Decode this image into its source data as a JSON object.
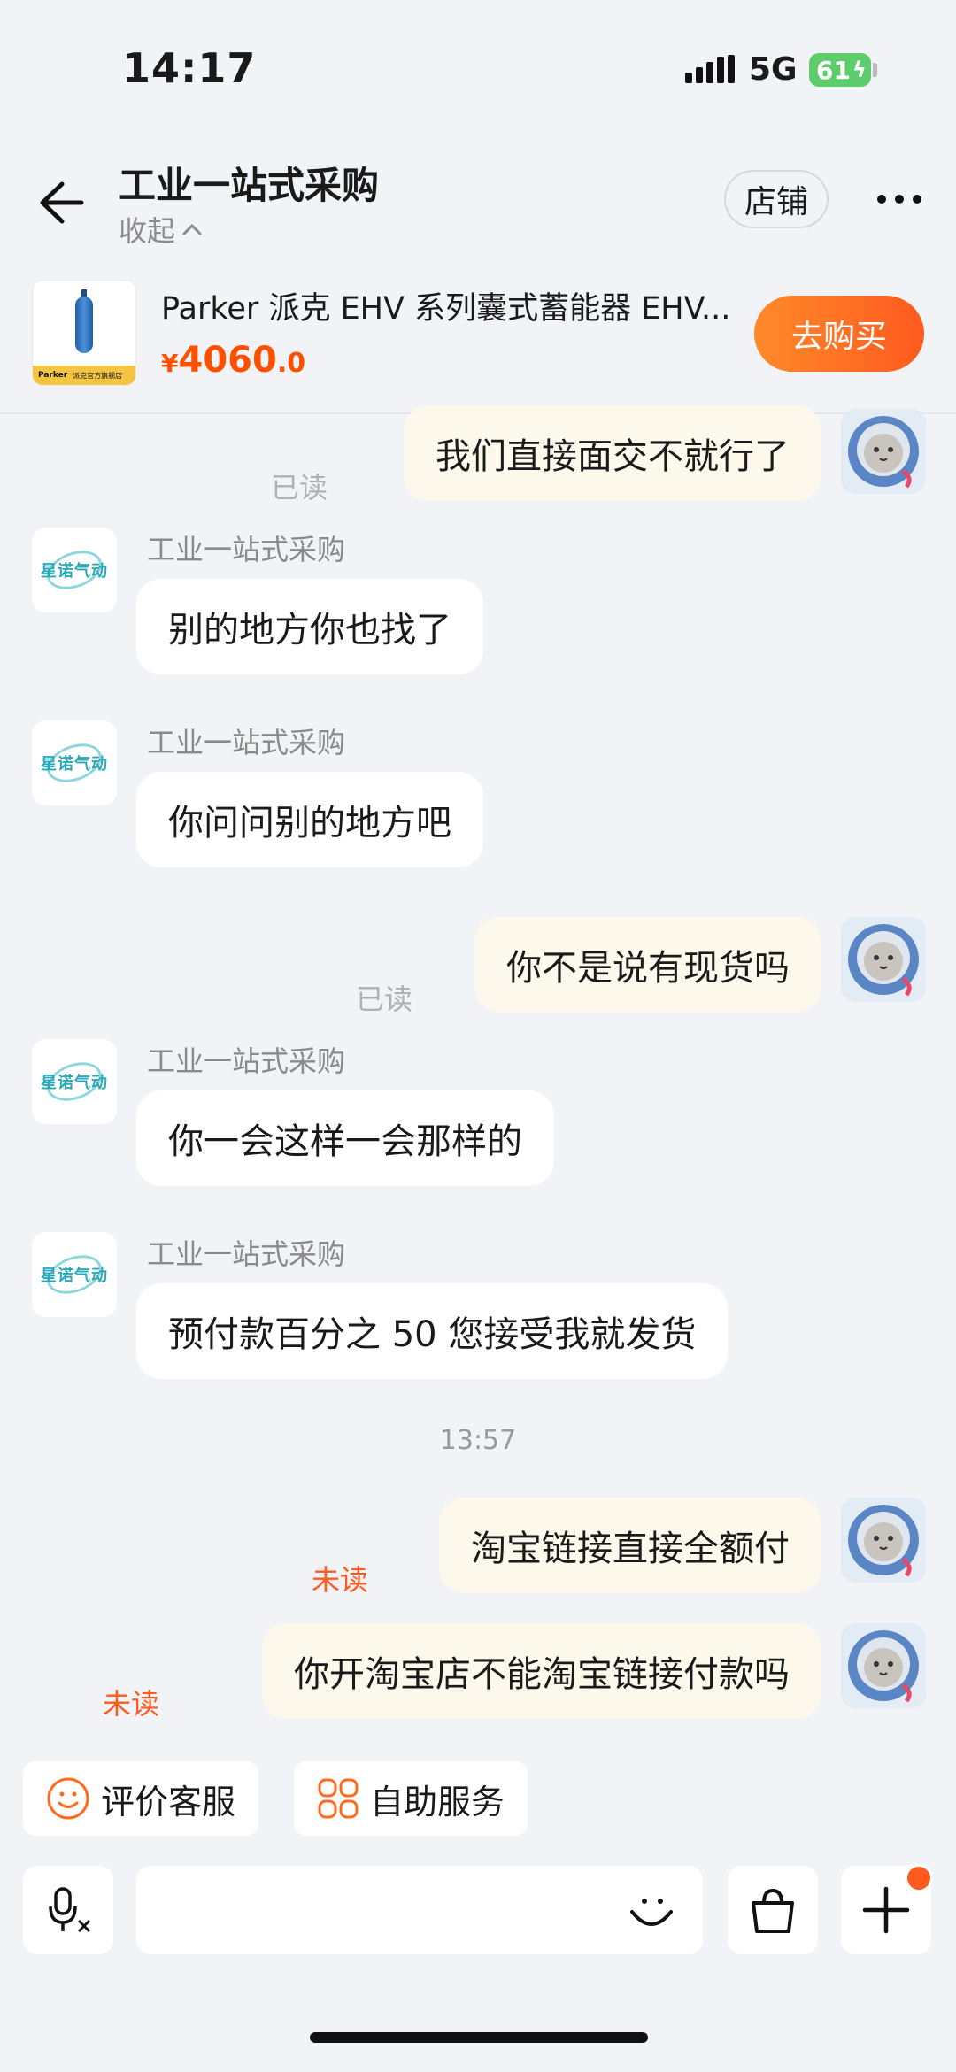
{
  "status_bar": {
    "time": "14:17",
    "network": "5G",
    "battery": "61"
  },
  "header": {
    "title": "工业一站式采购",
    "collapse_label": "收起",
    "store_button": "店铺"
  },
  "product": {
    "title": "Parker 派克 EHV 系列囊式蓄能器 EHV...",
    "currency": "¥",
    "price_int": "4060",
    "price_dec": ".0",
    "buy_button": "去购买",
    "thumb_brand": "Parker",
    "thumb_store": "派克官方旗舰店"
  },
  "shop_avatar_text": "星诺气动",
  "messages": [
    {
      "side": "out",
      "text": "我们直接面交不就行了",
      "status": "已读"
    },
    {
      "side": "in",
      "sender": "工业一站式采购",
      "text": "别的地方你也找了"
    },
    {
      "side": "in",
      "sender": "工业一站式采购",
      "text": "你问问别的地方吧"
    },
    {
      "side": "out",
      "text": "你不是说有现货吗",
      "status": "已读"
    },
    {
      "side": "in",
      "sender": "工业一站式采购",
      "text": "你一会这样一会那样的"
    },
    {
      "side": "in",
      "sender": "工业一站式采购",
      "text": "预付款百分之 50 您接受我就发货"
    },
    {
      "side": "out",
      "text": "淘宝链接直接全额付",
      "status": "未读"
    },
    {
      "side": "out",
      "text": "你开淘宝店不能淘宝链接付款吗",
      "status": "未读"
    }
  ],
  "timestamp": "13:57",
  "quick_actions": [
    {
      "label": "评价客服",
      "icon": "smile-icon"
    },
    {
      "label": "自助服务",
      "icon": "grid-icon"
    }
  ],
  "input_bar": {
    "icons": [
      "voice-translate-icon",
      "emoji-icon",
      "shopping-bag-icon",
      "plus-icon"
    ]
  },
  "colors": {
    "accent": "#ff5000",
    "bubble_out": "#fdf8ec",
    "bubble_in": "#ffffff",
    "background": "#f2f3f6"
  }
}
